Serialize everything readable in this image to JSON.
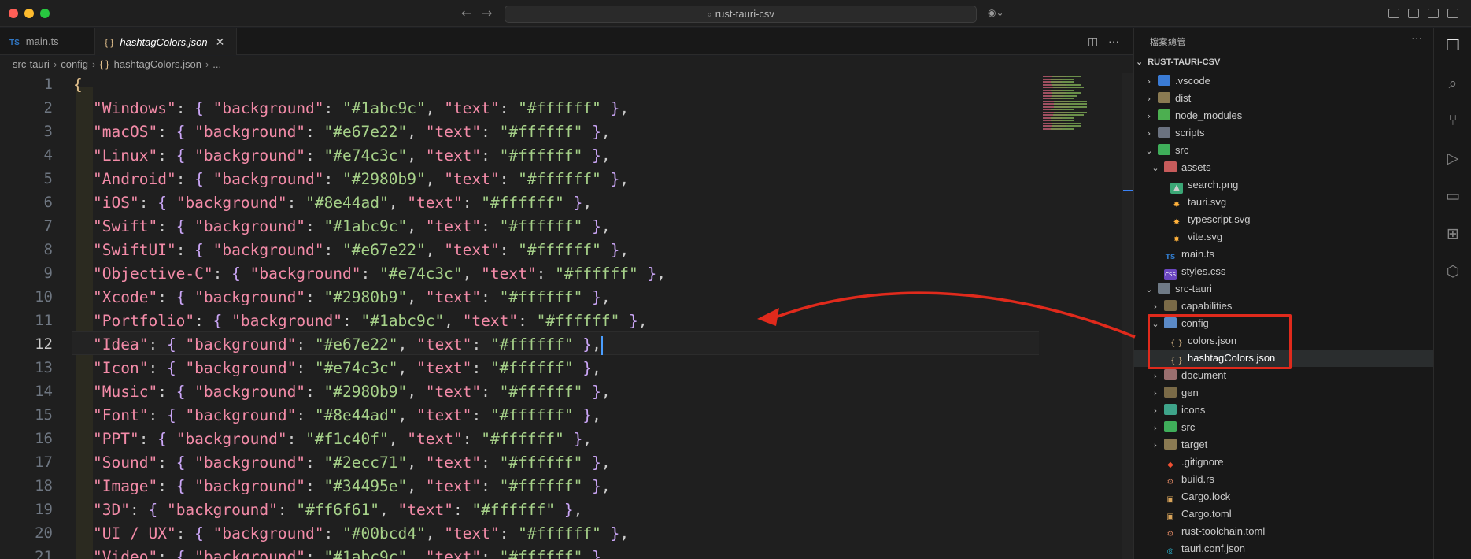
{
  "window": {
    "title": "rust-tauri-csv"
  },
  "tabs": [
    {
      "label": "main.ts",
      "type": "TS"
    },
    {
      "label": "hashtagColors.json",
      "type": "json",
      "active": true
    }
  ],
  "breadcrumb": {
    "items": [
      "src-tauri",
      "config",
      "hashtagColors.json",
      "..."
    ]
  },
  "editor": {
    "current_line": 12,
    "line_numbers": [
      "1",
      "2",
      "3",
      "4",
      "5",
      "6",
      "7",
      "8",
      "9",
      "10",
      "11",
      "12",
      "13",
      "14",
      "15",
      "16",
      "17",
      "18",
      "19",
      "20",
      "21"
    ],
    "entries": [
      {
        "key": "Windows",
        "background": "#1abc9c",
        "text": "#ffffff"
      },
      {
        "key": "macOS",
        "background": "#e67e22",
        "text": "#ffffff"
      },
      {
        "key": "Linux",
        "background": "#e74c3c",
        "text": "#ffffff"
      },
      {
        "key": "Android",
        "background": "#2980b9",
        "text": "#ffffff"
      },
      {
        "key": "iOS",
        "background": "#8e44ad",
        "text": "#ffffff"
      },
      {
        "key": "Swift",
        "background": "#1abc9c",
        "text": "#ffffff"
      },
      {
        "key": "SwiftUI",
        "background": "#e67e22",
        "text": "#ffffff"
      },
      {
        "key": "Objective-C",
        "background": "#e74c3c",
        "text": "#ffffff"
      },
      {
        "key": "Xcode",
        "background": "#2980b9",
        "text": "#ffffff"
      },
      {
        "key": "Portfolio",
        "background": "#1abc9c",
        "text": "#ffffff"
      },
      {
        "key": "Idea",
        "background": "#e67e22",
        "text": "#ffffff"
      },
      {
        "key": "Icon",
        "background": "#e74c3c",
        "text": "#ffffff"
      },
      {
        "key": "Music",
        "background": "#2980b9",
        "text": "#ffffff"
      },
      {
        "key": "Font",
        "background": "#8e44ad",
        "text": "#ffffff"
      },
      {
        "key": "PPT",
        "background": "#f1c40f",
        "text": "#ffffff"
      },
      {
        "key": "Sound",
        "background": "#2ecc71",
        "text": "#ffffff"
      },
      {
        "key": "Image",
        "background": "#34495e",
        "text": "#ffffff"
      },
      {
        "key": "3D",
        "background": "#ff6f61",
        "text": "#ffffff"
      },
      {
        "key": "UI / UX",
        "background": "#00bcd4",
        "text": "#ffffff"
      },
      {
        "key": "Video",
        "background": "#1abc9c",
        "text": "#ffffff"
      }
    ],
    "open_brace": "{"
  },
  "sidebar": {
    "title": "檔案總管",
    "root": "RUST-TAURI-CSV",
    "tree": [
      {
        "label": ".vscode",
        "depth": 0,
        "chev": "›",
        "icon": "folder-vscode"
      },
      {
        "label": "dist",
        "depth": 0,
        "chev": "›",
        "icon": "folder-dist"
      },
      {
        "label": "node_modules",
        "depth": 0,
        "chev": "›",
        "icon": "folder-node"
      },
      {
        "label": "scripts",
        "depth": 0,
        "chev": "›",
        "icon": "folder-scripts"
      },
      {
        "label": "src",
        "depth": 0,
        "chev": "⌄",
        "icon": "folder-src"
      },
      {
        "label": "assets",
        "depth": 1,
        "chev": "⌄",
        "icon": "folder-assets"
      },
      {
        "label": "search.png",
        "depth": 2,
        "chev": "",
        "icon": "img"
      },
      {
        "label": "tauri.svg",
        "depth": 2,
        "chev": "",
        "icon": "svg"
      },
      {
        "label": "typescript.svg",
        "depth": 2,
        "chev": "",
        "icon": "svg"
      },
      {
        "label": "vite.svg",
        "depth": 2,
        "chev": "",
        "icon": "svg"
      },
      {
        "label": "main.ts",
        "depth": 1,
        "chev": "",
        "icon": "ts"
      },
      {
        "label": "styles.css",
        "depth": 1,
        "chev": "",
        "icon": "css"
      },
      {
        "label": "src-tauri",
        "depth": 0,
        "chev": "⌄",
        "icon": "folder-tauri"
      },
      {
        "label": "capabilities",
        "depth": 1,
        "chev": "›",
        "icon": "folder"
      },
      {
        "label": "config",
        "depth": 1,
        "chev": "⌄",
        "icon": "folder-config"
      },
      {
        "label": "colors.json",
        "depth": 2,
        "chev": "",
        "icon": "json"
      },
      {
        "label": "hashtagColors.json",
        "depth": 2,
        "chev": "",
        "icon": "json",
        "selected": true
      },
      {
        "label": "document",
        "depth": 1,
        "chev": "›",
        "icon": "folder-doc"
      },
      {
        "label": "gen",
        "depth": 1,
        "chev": "›",
        "icon": "folder"
      },
      {
        "label": "icons",
        "depth": 1,
        "chev": "›",
        "icon": "folder-icons"
      },
      {
        "label": "src",
        "depth": 1,
        "chev": "›",
        "icon": "folder-src"
      },
      {
        "label": "target",
        "depth": 1,
        "chev": "›",
        "icon": "folder-target"
      },
      {
        "label": ".gitignore",
        "depth": 1,
        "chev": "",
        "icon": "git"
      },
      {
        "label": "build.rs",
        "depth": 1,
        "chev": "",
        "icon": "rust"
      },
      {
        "label": "Cargo.lock",
        "depth": 1,
        "chev": "",
        "icon": "cargo"
      },
      {
        "label": "Cargo.toml",
        "depth": 1,
        "chev": "",
        "icon": "cargo"
      },
      {
        "label": "rust-toolchain.toml",
        "depth": 1,
        "chev": "",
        "icon": "rust"
      },
      {
        "label": "tauri.conf.json",
        "depth": 1,
        "chev": "",
        "icon": "tauri"
      }
    ]
  },
  "colors": {
    "accent": "#0078d4",
    "annotation": "#e02a1c",
    "key": "#f38ba8",
    "string": "#a6d189",
    "brace": "#cba6f7"
  }
}
